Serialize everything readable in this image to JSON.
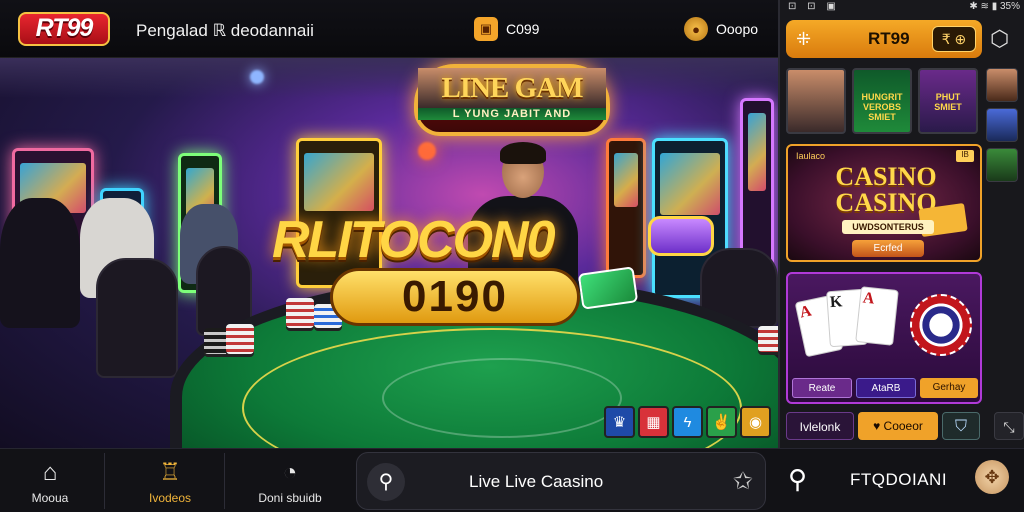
{
  "topbar": {
    "logo": "RT99",
    "title": "Pengalad ℝ deodannaii",
    "chip1_label": "C099",
    "chip1_icon": "wallet-icon",
    "chip2_label": "Ooopo",
    "chip2_icon": "coin-icon"
  },
  "hero": {
    "sign_title": "LINE GAM",
    "sign_subtitle": "L YUNG JABIT AND",
    "big_title": "RLITOCON0",
    "big_numbers": "0190",
    "quick_icons": [
      "trophy-icon",
      "slots-icon",
      "lightning-icon",
      "peace-icon",
      "coin-icon"
    ]
  },
  "panel": {
    "status_time": "",
    "status_right": "✱ ≋ ▮ 35%",
    "header_title": "RT99",
    "header_badge": "₹ ⊕",
    "thumbs": [
      {
        "caption": ""
      },
      {
        "caption": "HUNGRIT VEROBS SMIET"
      },
      {
        "caption": "PHUT SMIET"
      }
    ],
    "card1": {
      "small_label": "Iaulaco",
      "tag": "IB",
      "casino_line1": "CASINO",
      "casino_line2": "CASINO",
      "subline": "UWDSONTERUS",
      "play_label": "Ecrfed"
    },
    "card2": {
      "buttons": [
        "Reate",
        "AtaRB",
        "Gerhay"
      ]
    },
    "footer": {
      "tab1": "Ivlelonk",
      "tab2": "♥ Cooeor",
      "tab3_icon": "shield-icon",
      "tab4_icon": "expand-icon"
    }
  },
  "bottomnav": {
    "items": [
      {
        "label": "Mooua",
        "icon": "home-icon"
      },
      {
        "label": "Ivodeos",
        "icon": "casino-icon"
      },
      {
        "label": "Doni sbuidb",
        "icon": "dice-icon"
      }
    ],
    "search_label": "Live Live Caasino",
    "right_title": "FTQDOIANI",
    "colors": {
      "accent": "#f0b43a",
      "bar": "#121216"
    }
  }
}
